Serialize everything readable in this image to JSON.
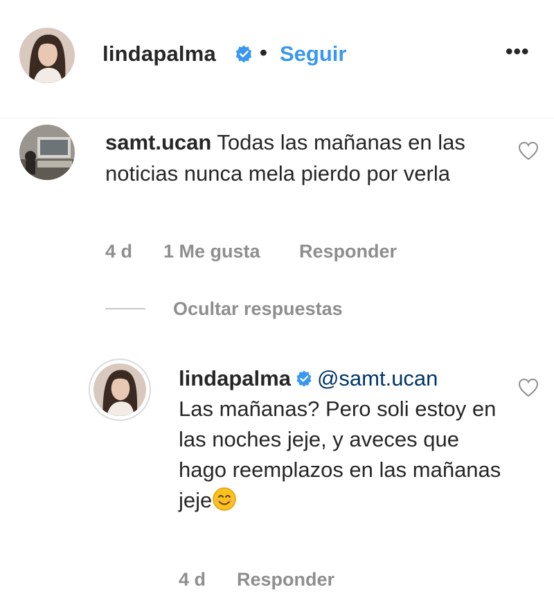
{
  "post": {
    "username": "lindapalma",
    "separator": "•",
    "follow_label": "Seguir",
    "more_label": "•••"
  },
  "comment": {
    "username": "samt.ucan",
    "text": "Todas las mañanas en las noticias nunca mela pierdo por verla",
    "time": "4 d",
    "likes": "1 Me gusta",
    "reply_label": "Responder"
  },
  "replies_toggle": {
    "label": "Ocultar respuestas"
  },
  "reply": {
    "username": "lindapalma",
    "mention": "@samt.ucan",
    "text": "Las mañanas? Pero soli estoy en las noches jeje, y aveces que hago reemplazos en las mañanas jeje",
    "emoji": "smiling-face-with-smiling-eyes",
    "time": "4 d",
    "reply_label": "Responder"
  },
  "colors": {
    "link_blue": "#3897f0",
    "mention_blue": "#003569",
    "meta_gray": "#8e8e8e",
    "text": "#262626",
    "verified_blue": "#3897f0"
  },
  "icons": [
    "verified-badge-icon",
    "more-options-icon",
    "heart-icon",
    "smiling-face-emoji-icon"
  ]
}
